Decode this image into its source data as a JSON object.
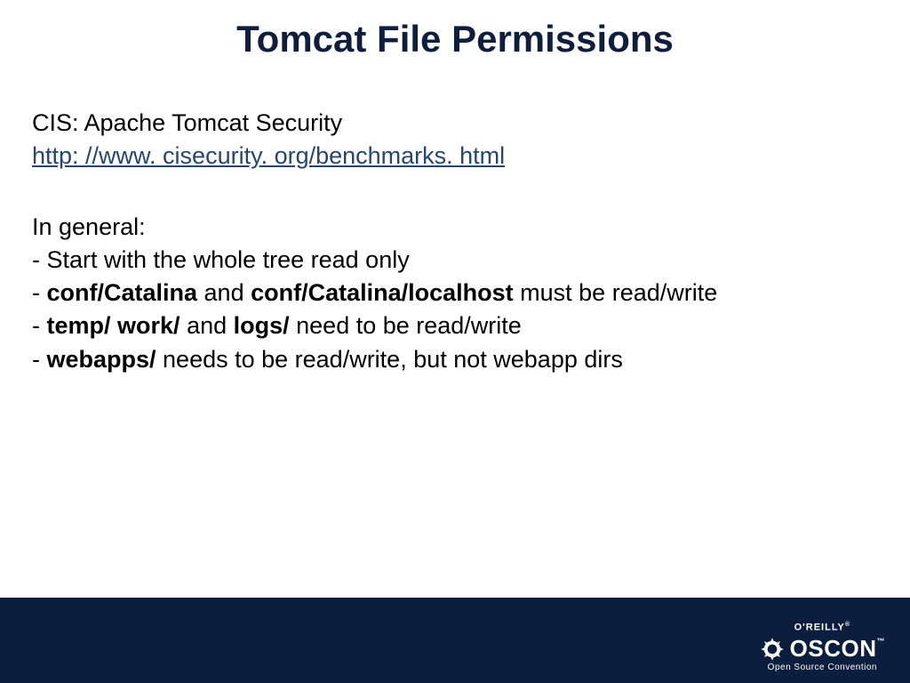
{
  "title": "Tomcat File Permissions",
  "intro": {
    "line1": "CIS: Apache Tomcat Security",
    "link_text": "http: //www. cisecurity. org/benchmarks. html",
    "link_href": "http://www.cisecurity.org/benchmarks.html"
  },
  "general": {
    "heading": "In general:",
    "b1_text": "- Start with the whole tree read only",
    "b2_pre": "- ",
    "b2_bold1": "conf/Catalina",
    "b2_mid": " and ",
    "b2_bold2": "conf/Catalina/localhost",
    "b2_post": " must be read/write",
    "b3_pre": "- ",
    "b3_bold1": "temp/",
    "b3_mid1": " ",
    "b3_bold2": "work/",
    "b3_mid2": " and ",
    "b3_bold3": "logs/",
    "b3_post": " need to be read/write",
    "b4_pre": "- ",
    "b4_bold": "webapps/",
    "b4_post": " needs to be read/write, but not webapp dirs"
  },
  "footer": {
    "brand": "O'REILLY",
    "conference": "OSCON",
    "tagline": "Open Source Convention"
  }
}
